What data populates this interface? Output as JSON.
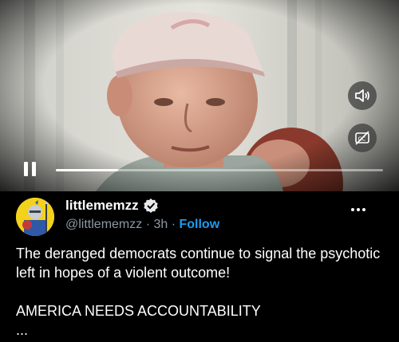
{
  "video": {
    "paused": true,
    "progress": 0.19,
    "controls": {
      "volume_icon": "volume-icon",
      "cc_icon": "captions-off-icon",
      "pause_icon": "pause-icon"
    }
  },
  "post": {
    "display_name": "littlememzz",
    "verified": true,
    "handle": "@littlememzz",
    "separator": " · ",
    "time": "3h",
    "dot": " · ",
    "follow_label": "Follow",
    "text_line1": "The deranged democrats continue to signal the psychotic left in hopes of a violent outcome!",
    "text_line2": "AMERICA NEEDS ACCOUNTABILITY",
    "ellipsis": "..."
  },
  "colors": {
    "link": "#1d9bf0",
    "muted": "#8b98a5",
    "avatar_bg": "#f2d21b",
    "background": "#000000"
  }
}
